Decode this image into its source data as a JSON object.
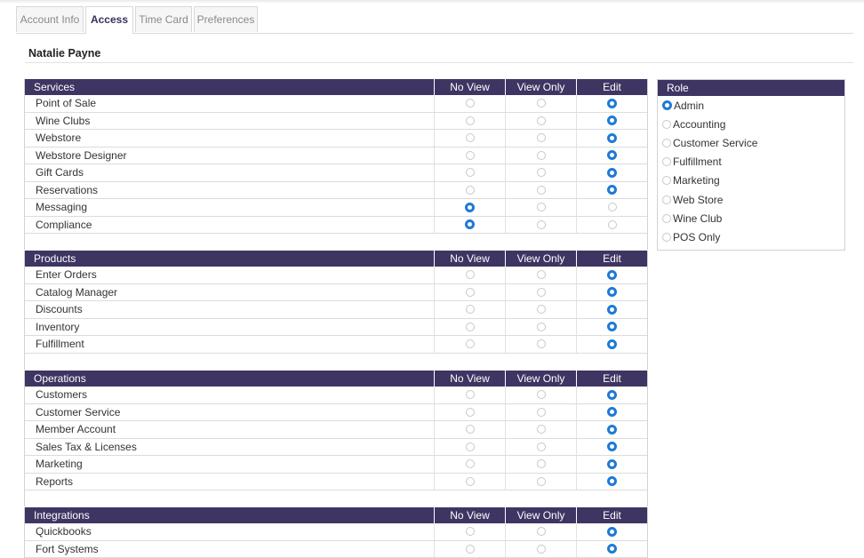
{
  "tabs": [
    {
      "label": "Account Info",
      "active": false
    },
    {
      "label": "Access",
      "active": true
    },
    {
      "label": "Time Card",
      "active": false
    },
    {
      "label": "Preferences",
      "active": false
    }
  ],
  "user_name": "Natalie Payne",
  "columns": [
    "No View",
    "View Only",
    "Edit"
  ],
  "sections": [
    {
      "title": "Services",
      "rows": [
        {
          "label": "Point of Sale",
          "selected": "Edit"
        },
        {
          "label": "Wine Clubs",
          "selected": "Edit"
        },
        {
          "label": "Webstore",
          "selected": "Edit"
        },
        {
          "label": "Webstore Designer",
          "selected": "Edit"
        },
        {
          "label": "Gift Cards",
          "selected": "Edit"
        },
        {
          "label": "Reservations",
          "selected": "Edit"
        },
        {
          "label": "Messaging",
          "selected": "No View"
        },
        {
          "label": "Compliance",
          "selected": "No View"
        }
      ]
    },
    {
      "title": "Products",
      "rows": [
        {
          "label": "Enter Orders",
          "selected": "Edit"
        },
        {
          "label": "Catalog Manager",
          "selected": "Edit"
        },
        {
          "label": "Discounts",
          "selected": "Edit"
        },
        {
          "label": "Inventory",
          "selected": "Edit"
        },
        {
          "label": "Fulfillment",
          "selected": "Edit"
        }
      ]
    },
    {
      "title": "Operations",
      "rows": [
        {
          "label": "Customers",
          "selected": "Edit"
        },
        {
          "label": "Customer Service",
          "selected": "Edit"
        },
        {
          "label": "Member Account",
          "selected": "Edit"
        },
        {
          "label": "Sales Tax & Licenses",
          "selected": "Edit"
        },
        {
          "label": "Marketing",
          "selected": "Edit"
        },
        {
          "label": "Reports",
          "selected": "Edit"
        }
      ]
    },
    {
      "title": "Integrations",
      "rows": [
        {
          "label": "Quickbooks",
          "selected": "Edit"
        },
        {
          "label": "Fort Systems",
          "selected": "Edit"
        }
      ]
    }
  ],
  "role": {
    "title": "Role",
    "selected": "Admin",
    "options": [
      "Admin",
      "Accounting",
      "Customer Service",
      "Fulfillment",
      "Marketing",
      "Web Store",
      "Wine Club",
      "POS Only"
    ]
  },
  "colors": {
    "header": "#3f3563",
    "radio_selected": "#1e7ad6",
    "active_tab_text": "#3b2f5a"
  },
  "icons": {
    "radio_selected": "radio-selected-icon",
    "radio_unselected": "radio-unselected-icon"
  }
}
